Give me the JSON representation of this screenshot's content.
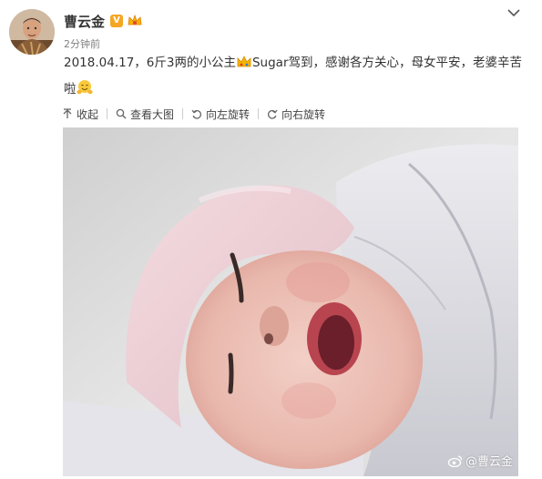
{
  "post": {
    "username": "曹云金",
    "verified_badge": "V",
    "time": "2分钟前",
    "text_before_emoji": "2018.04.17，6斤3两的小公主",
    "text_after_crown": "Sugar驾到，感谢各方关心，母女平安，老婆辛苦啦",
    "emojis": [
      "crown-emoji",
      "hugging-emoji"
    ]
  },
  "actions": {
    "collapse": "收起",
    "view_large": "查看大图",
    "rotate_left": "向左旋转",
    "rotate_right": "向右旋转"
  },
  "photo": {
    "watermark_handle": "@曹云金"
  },
  "colors": {
    "verified": "#f5a623",
    "link": "#eb7350",
    "muted": "#808080"
  }
}
